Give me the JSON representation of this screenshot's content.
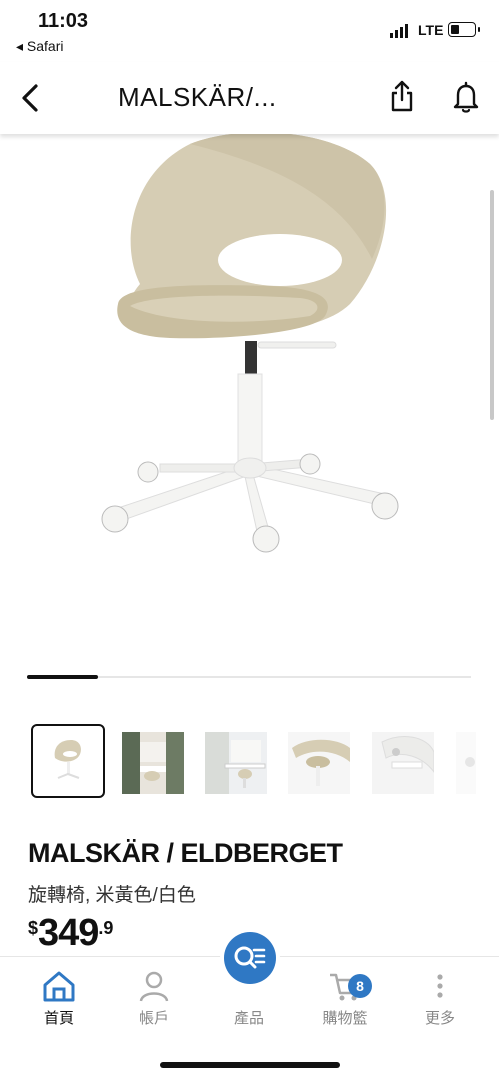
{
  "status_bar": {
    "time": "11:03",
    "back_app": "◂ Safari",
    "carrier": "LTE"
  },
  "navbar": {
    "title": "MALSKÄR/..."
  },
  "gallery": {
    "progress": 0.16,
    "thumbnail_count": 6,
    "selected_index": 0
  },
  "product": {
    "name": "MALSKÄR / ELDBERGET",
    "description": "旋轉椅, 米黃色/白色",
    "price_currency": "$",
    "price_integer": "349",
    "price_decimal": ".9"
  },
  "tabbar": {
    "tabs": [
      {
        "label": "首頁",
        "icon": "home-icon",
        "active": true
      },
      {
        "label": "帳戶",
        "icon": "account-icon",
        "active": false
      },
      {
        "label": "產品",
        "icon": "product-search-icon",
        "active": false
      },
      {
        "label": "購物籃",
        "icon": "cart-icon",
        "active": false
      },
      {
        "label": "更多",
        "icon": "more-icon",
        "active": false
      }
    ],
    "cart_badge": "8"
  },
  "colors": {
    "accent": "#2f78c4",
    "chair_seat": "#d6cdb4",
    "chair_frame": "#f4f4f2"
  }
}
